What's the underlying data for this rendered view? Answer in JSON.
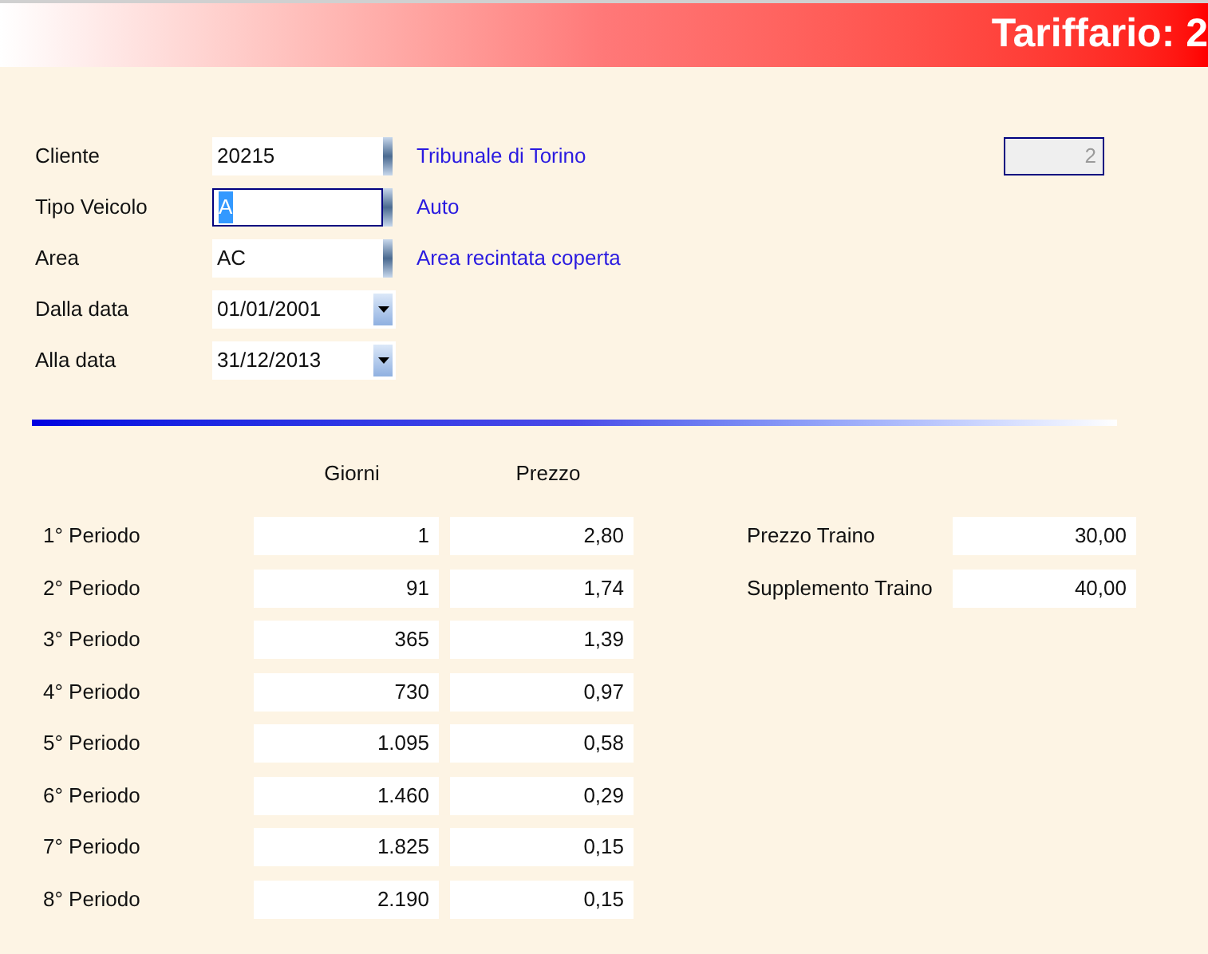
{
  "window": {
    "title": "Tariffario: 2"
  },
  "form": [
    {
      "label": "Cliente",
      "kind": "lookup",
      "value": "20215",
      "focused": false,
      "description": "Tribunale di Torino"
    },
    {
      "label": "Tipo Veicolo",
      "kind": "lookup",
      "value": "A",
      "focused": true,
      "description": "Auto"
    },
    {
      "label": "Area",
      "kind": "lookup",
      "value": "AC",
      "focused": false,
      "description": "Area recintata coperta"
    },
    {
      "label": "Dalla data",
      "kind": "date",
      "value": "01/01/2001",
      "focused": false
    },
    {
      "label": "Alla data",
      "kind": "date",
      "value": "31/12/2013",
      "focused": false
    }
  ],
  "record_field": {
    "value": "2",
    "disabled": true
  },
  "periods": {
    "columns": [
      "Giorni",
      "Prezzo"
    ],
    "rows": [
      {
        "label": "1° Periodo",
        "giorni": "1",
        "prezzo": "2,80"
      },
      {
        "label": "2° Periodo",
        "giorni": "91",
        "prezzo": "1,74"
      },
      {
        "label": "3° Periodo",
        "giorni": "365",
        "prezzo": "1,39"
      },
      {
        "label": "4° Periodo",
        "giorni": "730",
        "prezzo": "0,97"
      },
      {
        "label": "5° Periodo",
        "giorni": "1.095",
        "prezzo": "0,58"
      },
      {
        "label": "6° Periodo",
        "giorni": "1.460",
        "prezzo": "0,29"
      },
      {
        "label": "7° Periodo",
        "giorni": "1.825",
        "prezzo": "0,15"
      },
      {
        "label": "8° Periodo",
        "giorni": "2.190",
        "prezzo": "0,15"
      }
    ]
  },
  "towing": [
    {
      "label": "Prezzo Traino",
      "value": "30,00"
    },
    {
      "label": "Supplemento Traino",
      "value": "40,00"
    }
  ]
}
